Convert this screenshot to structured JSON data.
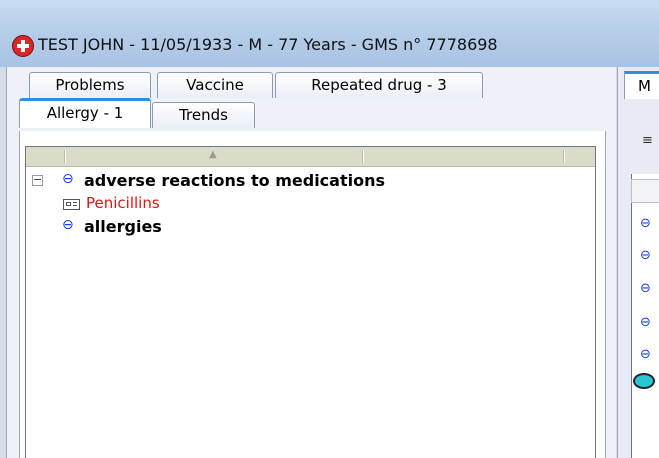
{
  "window": {
    "title": "TEST JOHN - 11/05/1933 - M - 77 Years - GMS n° 7778698"
  },
  "tabs_row1": [
    {
      "label": "Problems"
    },
    {
      "label": "Vaccine"
    },
    {
      "label": "Repeated drug - 3"
    }
  ],
  "tabs_row2": [
    {
      "label": "Allergy - 1",
      "active": true
    },
    {
      "label": "Trends"
    }
  ],
  "tree": {
    "items": [
      {
        "label": "adverse reactions to medications",
        "style": "bold",
        "expander": "−"
      },
      {
        "label": "Penicillins",
        "style": "red"
      },
      {
        "label": "allergies",
        "style": "bold"
      }
    ]
  },
  "right_panel": {
    "tab_label": "M",
    "icon_glyph": "⊖"
  },
  "colors": {
    "accent_blue": "#2e8ee2",
    "node_blue": "#1c3ee0",
    "warning_red": "#e31313"
  }
}
